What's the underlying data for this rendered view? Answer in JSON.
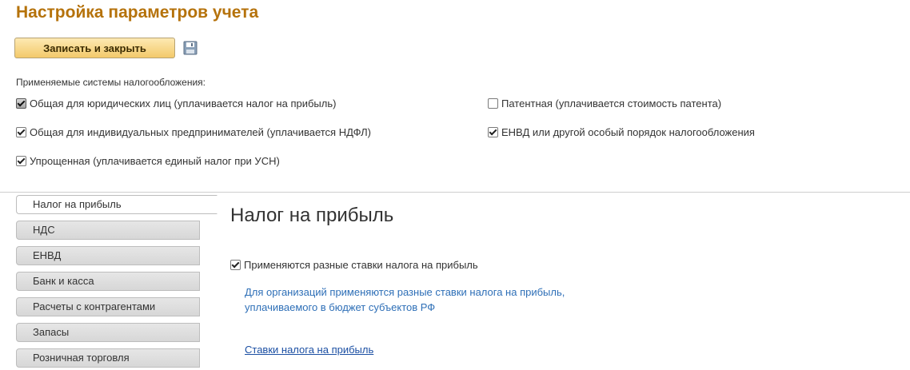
{
  "header": {
    "title": "Настройка параметров учета"
  },
  "toolbar": {
    "save_close_label": "Записать и закрыть",
    "save_icon": "floppy-disk-icon"
  },
  "tax_systems": {
    "label": "Применяемые системы налогообложения:",
    "items": [
      {
        "label": "Общая для юридических лиц (уплачивается налог на прибыль)",
        "checked": true
      },
      {
        "label": "Общая для индивидуальных предпринимателей (уплачивается НДФЛ)",
        "checked": true
      },
      {
        "label": "Упрощенная (уплачивается единый налог при УСН)",
        "checked": true
      },
      {
        "label": "Патентная (уплачивается стоимость патента)",
        "checked": false
      },
      {
        "label": "ЕНВД или другой особый порядок налогообложения",
        "checked": true
      }
    ]
  },
  "tabs": [
    {
      "label": "Налог на прибыль",
      "active": true
    },
    {
      "label": "НДС",
      "active": false
    },
    {
      "label": "ЕНВД",
      "active": false
    },
    {
      "label": "Банк и касса",
      "active": false
    },
    {
      "label": "Расчеты с контрагентами",
      "active": false
    },
    {
      "label": "Запасы",
      "active": false
    },
    {
      "label": "Розничная торговля",
      "active": false
    }
  ],
  "panel": {
    "title": "Налог на прибыль",
    "checkbox_label": "Применяются разные ставки налога на прибыль",
    "checkbox_checked": true,
    "note_line1": "Для организаций применяются разные ставки налога на прибыль,",
    "note_line2": "уплачиваемого в бюджет субъектов РФ",
    "link": "Ставки налога на прибыль"
  },
  "colors": {
    "title": "#b5720b",
    "note": "#2e6fb7",
    "link": "#1b4fa3",
    "button": "#f3c96a"
  }
}
